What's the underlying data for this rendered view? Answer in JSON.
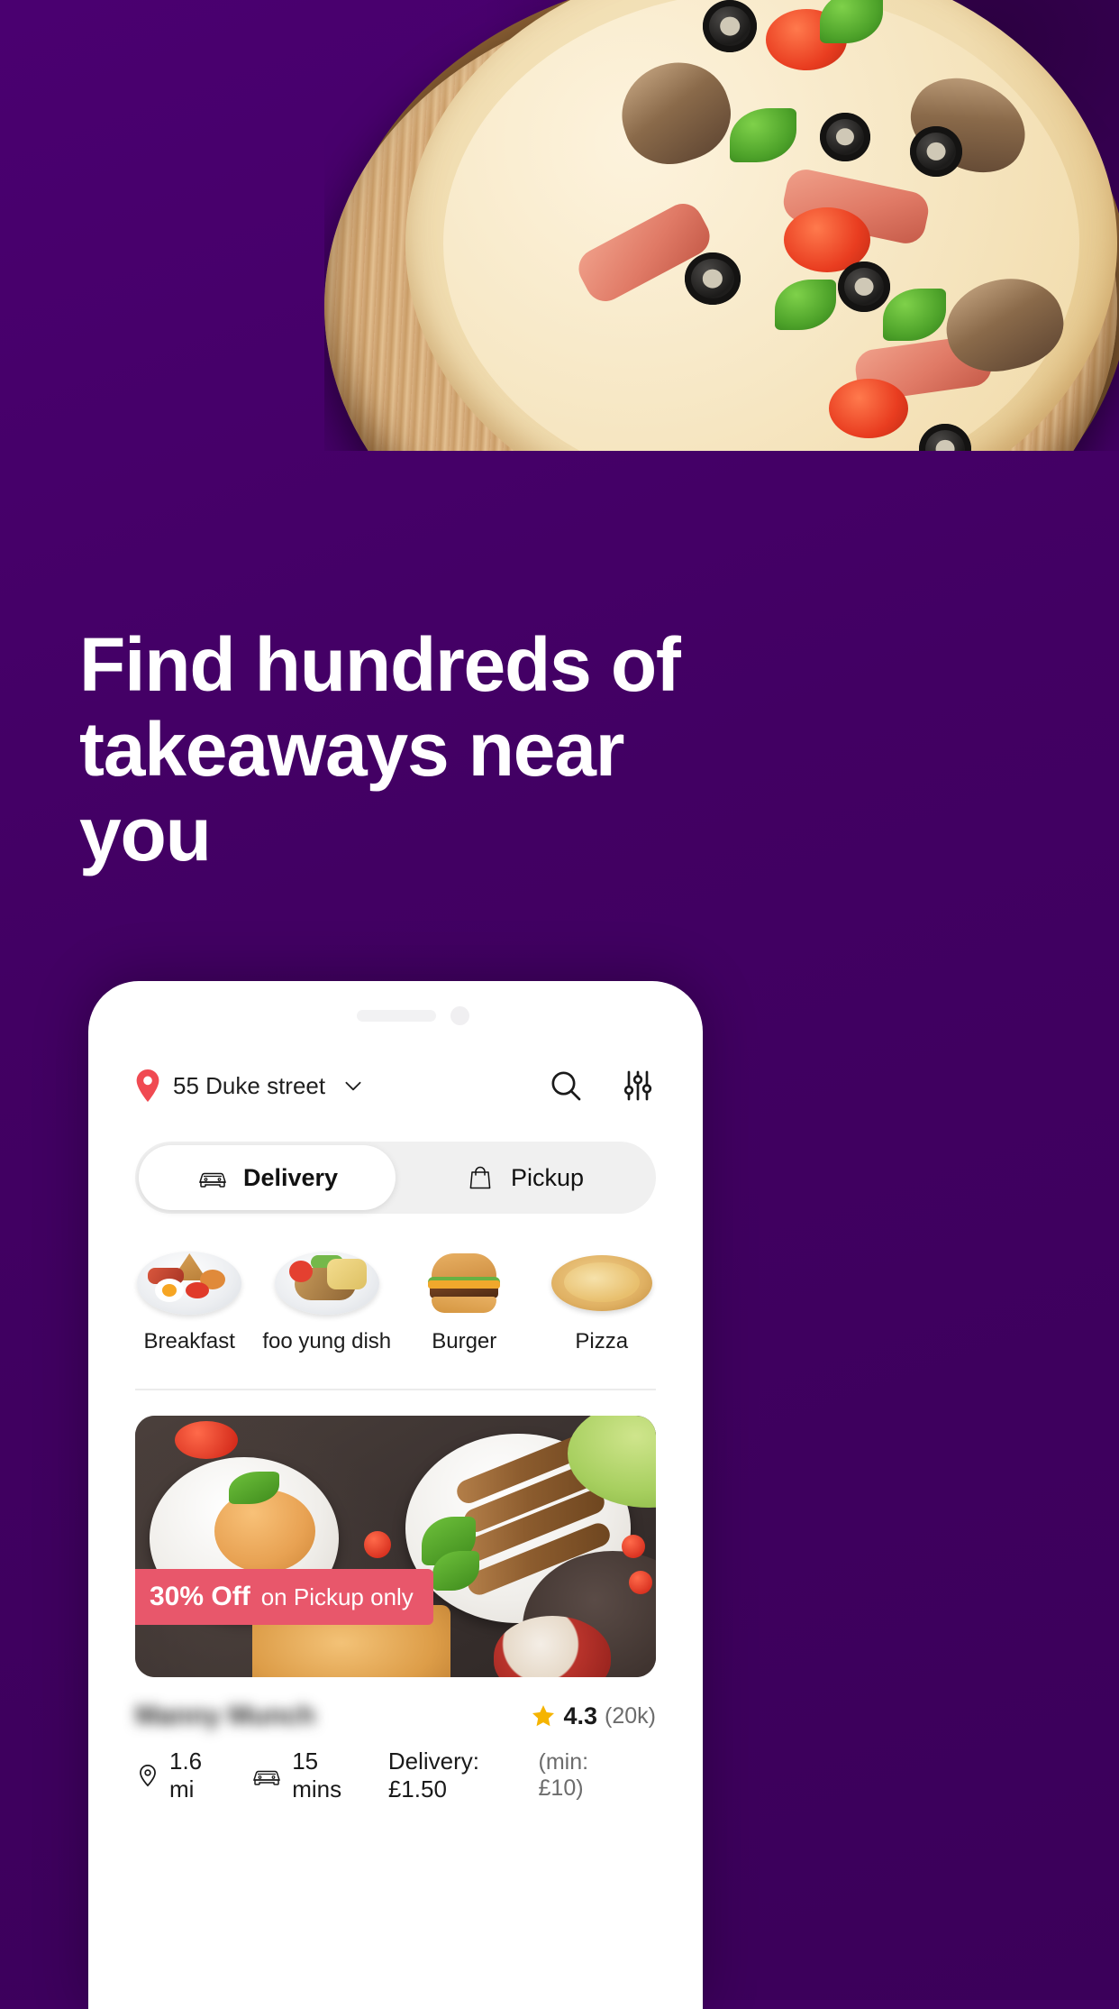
{
  "theme": {
    "background_purple": "#420063",
    "accent_pin_red": "#f04a52",
    "promo_red": "#e8576b",
    "star_gold": "#f5b400"
  },
  "hero": {
    "headline_line_1": "Find hundreds of",
    "headline_line_2": "takeaways near you",
    "photo": "pizza-on-wooden-board"
  },
  "phone": {
    "address_bar": {
      "pin_icon": "location-pin-icon",
      "address": "55 Duke street",
      "chevron_icon": "chevron-down-icon",
      "search_icon": "search-icon",
      "filters_icon": "filters-icon"
    },
    "mode_toggle": {
      "selected": "Delivery",
      "options": [
        {
          "label": "Delivery",
          "icon": "car-icon",
          "active": true
        },
        {
          "label": "Pickup",
          "icon": "shopping-bag-icon",
          "active": false
        }
      ]
    },
    "categories": [
      {
        "label": "Breakfast",
        "image": "breakfast-plate"
      },
      {
        "label": "foo yung dish",
        "image": "foo-yung-plate"
      },
      {
        "label": "Burger",
        "image": "burger"
      },
      {
        "label": "Pizza",
        "image": "pizza"
      }
    ],
    "restaurant_card": {
      "promo": {
        "discount": "30% Off",
        "condition": "on Pickup only"
      },
      "name": "Manny Munch",
      "name_redacted": true,
      "rating": {
        "star_icon": "star-icon",
        "value": "4.3",
        "count": "(20k)"
      },
      "meta": {
        "distance_icon": "location-target-icon",
        "distance": "1.6 mi",
        "time_icon": "car-icon",
        "time": "15 mins",
        "delivery": "Delivery: £1.50",
        "minimum": "(min: £10)"
      }
    }
  }
}
